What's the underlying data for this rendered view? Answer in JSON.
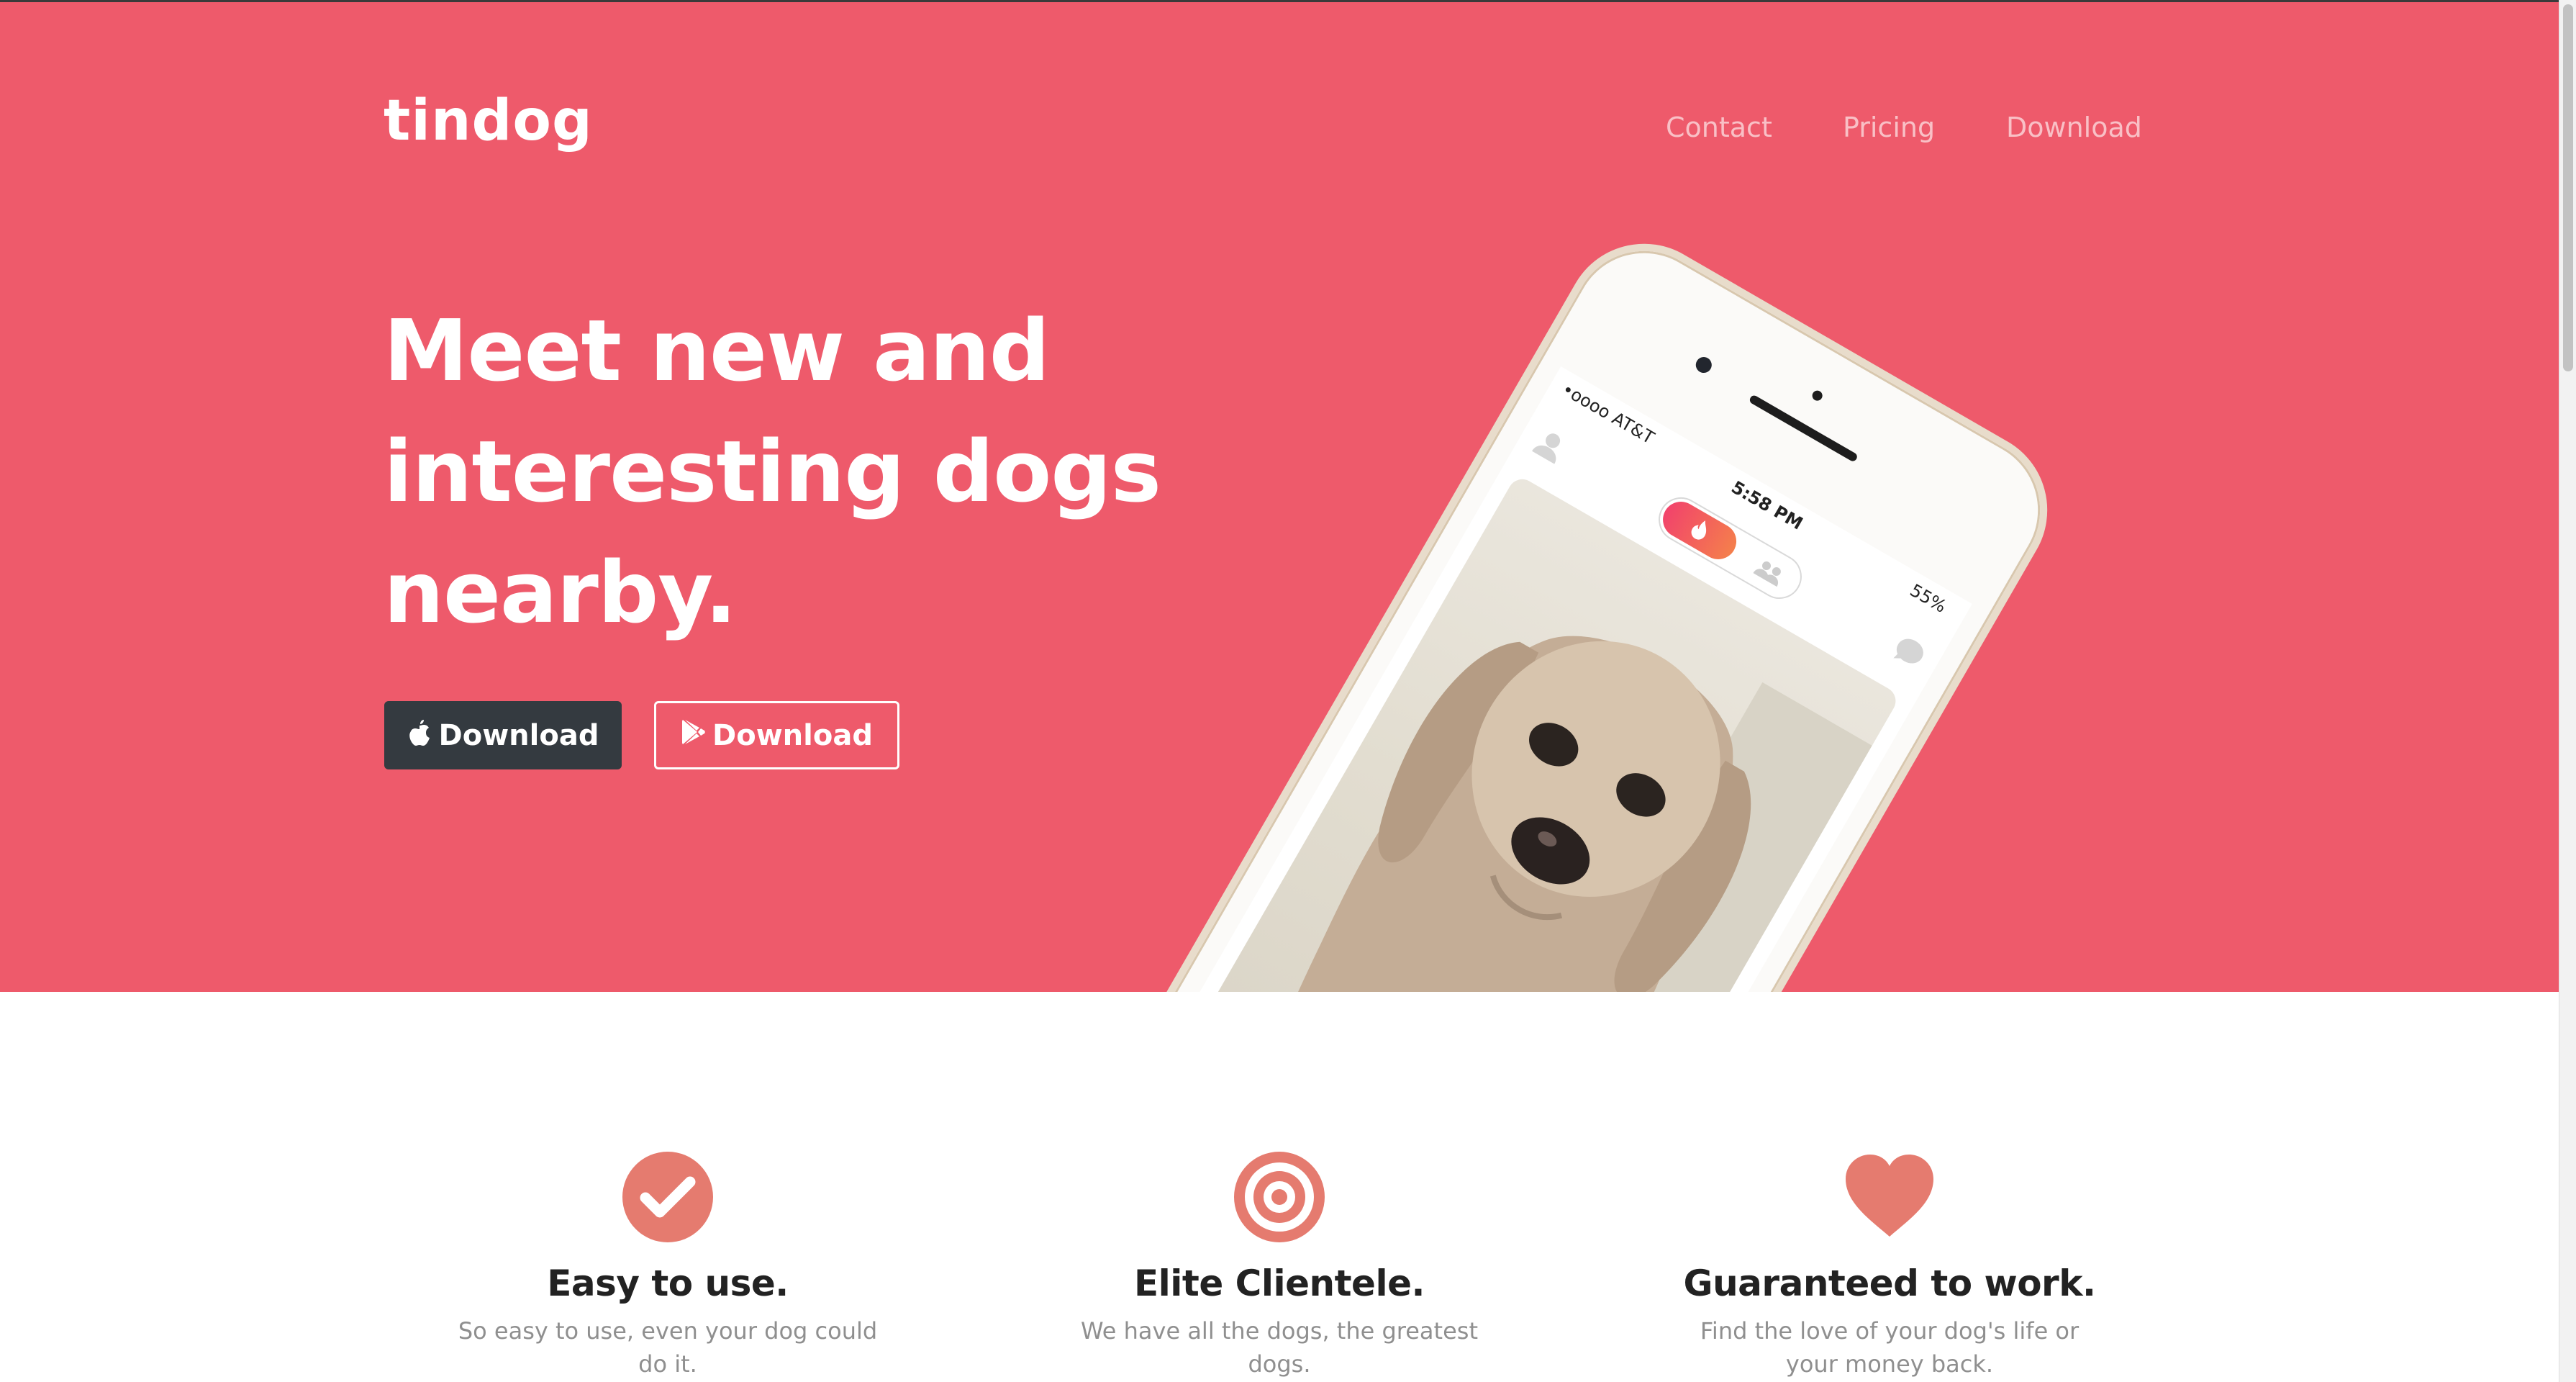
{
  "colors": {
    "hero_bg": "#ee5a6b",
    "dark_button": "#343a40",
    "feature_icon": "#e57b6f",
    "heading_text": "#222222",
    "muted_text": "#8f8f8f"
  },
  "brand": {
    "name": "tindog"
  },
  "nav": {
    "links": [
      "Contact",
      "Pricing",
      "Download"
    ]
  },
  "hero": {
    "headline_lines": [
      "Meet new and",
      "interesting dogs",
      "nearby."
    ],
    "buttons": [
      {
        "label": "Download",
        "icon": "apple-icon"
      },
      {
        "label": "Download",
        "icon": "google-play-icon"
      }
    ]
  },
  "phone": {
    "carrier": "•oooo AT&T",
    "time": "5:58 PM",
    "battery": "55%"
  },
  "features": [
    {
      "icon": "check-circle-icon",
      "title": "Easy to use.",
      "text": "So easy to use, even your dog could do it."
    },
    {
      "icon": "bullseye-icon",
      "title": "Elite Clientele.",
      "text": "We have all the dogs, the greatest dogs."
    },
    {
      "icon": "heart-icon",
      "title": "Guaranteed to work.",
      "text": "Find the love of your dog's life or your money back."
    }
  ]
}
